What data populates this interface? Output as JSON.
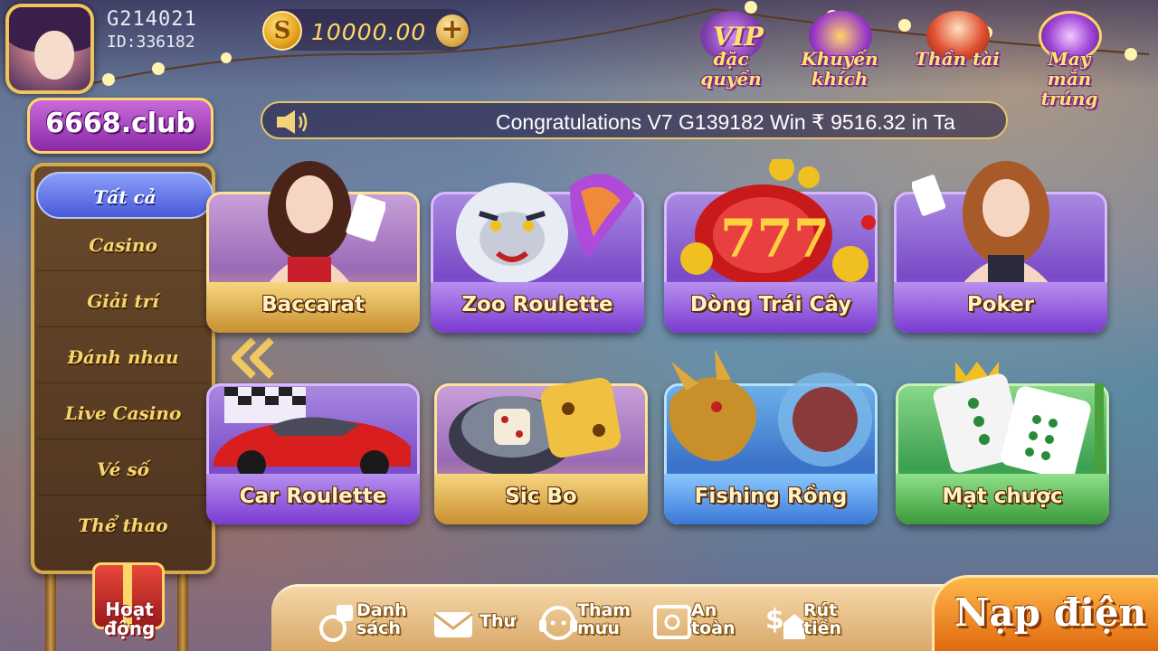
{
  "user": {
    "name": "G214021",
    "id": "ID:336182",
    "balance": "10000.00"
  },
  "promos": {
    "vip": "VIP",
    "vip_label": "đặc quyền",
    "khuyen_khich": "Khuyến khích",
    "than_tai": "Thần tài",
    "may_man": "May mắn trúng"
  },
  "logo": "6668.club",
  "marquee": {
    "text": "Congratulations V7 G139182 Win ₹ 9516.32 in Ta"
  },
  "categories": [
    {
      "label": "Tất cả",
      "active": true
    },
    {
      "label": "Casino",
      "active": false
    },
    {
      "label": "Giải trí",
      "active": false
    },
    {
      "label": "Đánh nhau",
      "active": false
    },
    {
      "label": "Live Casino",
      "active": false
    },
    {
      "label": "Vé số",
      "active": false
    },
    {
      "label": "Thể thao",
      "active": false
    }
  ],
  "activity": "Hoạt động",
  "games": [
    {
      "name": "Baccarat"
    },
    {
      "name": "Zoo Roulette"
    },
    {
      "name": "Dòng Trái Cây"
    },
    {
      "name": "Poker"
    },
    {
      "name": "Car Roulette"
    },
    {
      "name": "Sic Bo"
    },
    {
      "name": "Fishing Rồng"
    },
    {
      "name": "Mạt chược"
    }
  ],
  "bottom_nav": {
    "danh_sach": "Danh sách",
    "thu": "Thư",
    "tham_muu": "Tham mưu",
    "an_toan": "An toàn",
    "rut_tien": "Rút tiền",
    "nap_dien": "Nạp điện"
  },
  "colors": {
    "accent_gold": "#ffd76a",
    "active_tab": "#4a5ad8",
    "deposit_orange": "#e06a10"
  }
}
